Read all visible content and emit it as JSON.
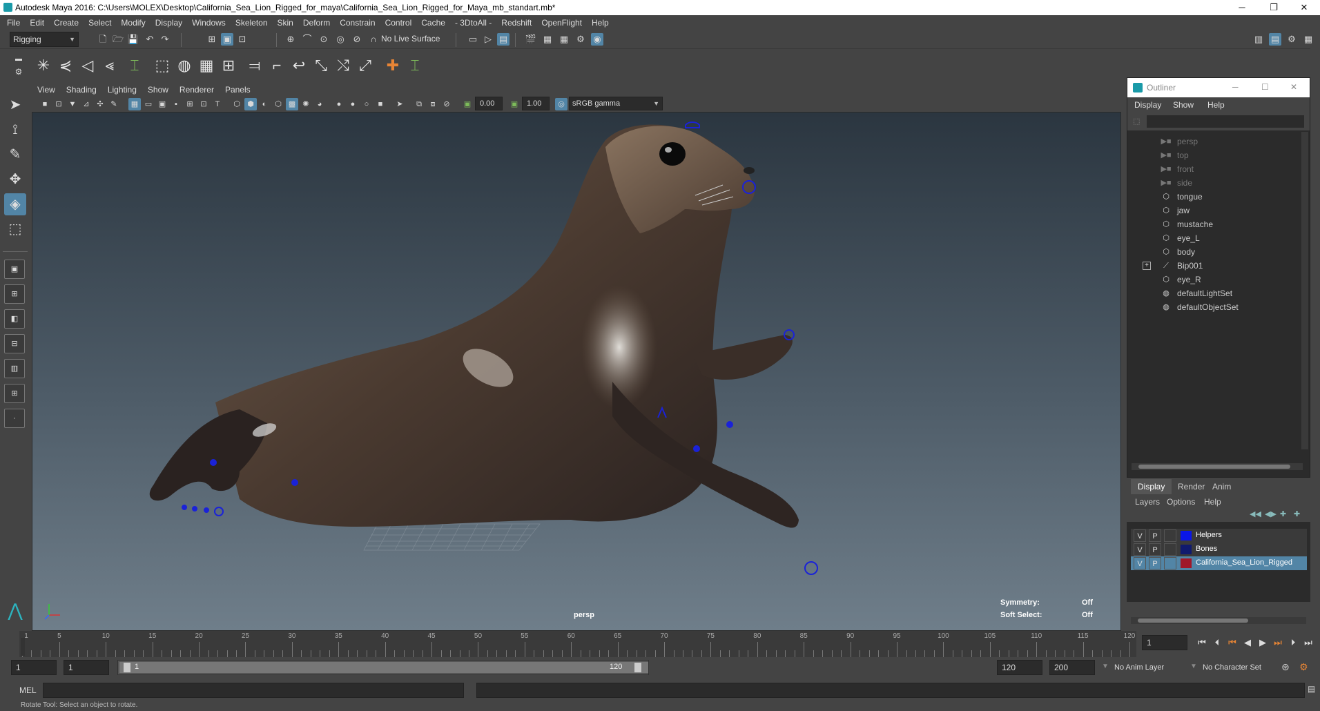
{
  "window": {
    "title": "Autodesk Maya 2016: C:\\Users\\MOLEX\\Desktop\\California_Sea_Lion_Rigged_for_maya\\California_Sea_Lion_Rigged_for_Maya_mb_standart.mb*",
    "minimize": "─",
    "restore": "❐",
    "close": "✕"
  },
  "menubar": [
    "File",
    "Edit",
    "Create",
    "Select",
    "Modify",
    "Display",
    "Windows",
    "Skeleton",
    "Skin",
    "Deform",
    "Constrain",
    "Control",
    "Cache",
    "- 3DtoAll -",
    "Redshift",
    "OpenFlight",
    "Help"
  ],
  "statusline": {
    "menuset": "Rigging",
    "live_surface": "No Live Surface"
  },
  "panel": {
    "menus": [
      "View",
      "Shading",
      "Lighting",
      "Show",
      "Renderer",
      "Panels"
    ],
    "near_value": "0.00",
    "far_value": "1.00",
    "color_space": "sRGB gamma"
  },
  "viewport": {
    "camera_label": "persp",
    "symmetry_label": "Symmetry:",
    "symmetry_value": "Off",
    "soft_select_label": "Soft Select:",
    "soft_select_value": "Off"
  },
  "outliner": {
    "title": "Outliner",
    "menus": [
      "Display",
      "Show",
      "Help"
    ],
    "items": [
      {
        "label": "persp",
        "icon": "camera-icon",
        "dim": true
      },
      {
        "label": "top",
        "icon": "camera-icon",
        "dim": true
      },
      {
        "label": "front",
        "icon": "camera-icon",
        "dim": true
      },
      {
        "label": "side",
        "icon": "camera-icon",
        "dim": true
      },
      {
        "label": "tongue",
        "icon": "mesh-icon",
        "dim": false
      },
      {
        "label": "jaw",
        "icon": "mesh-icon",
        "dim": false
      },
      {
        "label": "mustache",
        "icon": "mesh-icon",
        "dim": false
      },
      {
        "label": "eye_L",
        "icon": "mesh-icon",
        "dim": false
      },
      {
        "label": "body",
        "icon": "mesh-icon",
        "dim": false
      },
      {
        "label": "Bip001",
        "icon": "joint-icon",
        "dim": false,
        "expandable": true
      },
      {
        "label": "eye_R",
        "icon": "mesh-icon",
        "dim": false
      },
      {
        "label": "defaultLightSet",
        "icon": "set-icon",
        "dim": false
      },
      {
        "label": "defaultObjectSet",
        "icon": "set-icon",
        "dim": false
      }
    ]
  },
  "layer_editor": {
    "tabs": [
      "Display",
      "Render",
      "Anim"
    ],
    "menus": [
      "Layers",
      "Options",
      "Help"
    ],
    "layers": [
      {
        "v": "V",
        "p": "P",
        "name": "Helpers",
        "color": "#0a16e8",
        "selected": false
      },
      {
        "v": "V",
        "p": "P",
        "name": "Bones",
        "color": "#101a6e",
        "selected": false
      },
      {
        "v": "V",
        "p": "P",
        "name": "California_Sea_Lion_Rigged",
        "color": "#a0182a",
        "selected": true
      }
    ]
  },
  "timeslider": {
    "labels": [
      "1",
      "5",
      "10",
      "15",
      "20",
      "25",
      "30",
      "35",
      "40",
      "45",
      "50",
      "55",
      "60",
      "65",
      "70",
      "75",
      "80",
      "85",
      "90",
      "95",
      "100",
      "105",
      "110",
      "115",
      "120"
    ],
    "current_frame": "1"
  },
  "range": {
    "start": "1",
    "playback_start": "1",
    "slider_start": "1",
    "slider_end": "120",
    "playback_end": "120",
    "end": "200",
    "anim_layer": "No Anim Layer",
    "character_set": "No Character Set"
  },
  "cmdline": {
    "label": "MEL"
  },
  "helpline": "Rotate Tool: Select an object to rotate.",
  "colors": {
    "accent": "#5285a6",
    "bg": "#444444"
  }
}
